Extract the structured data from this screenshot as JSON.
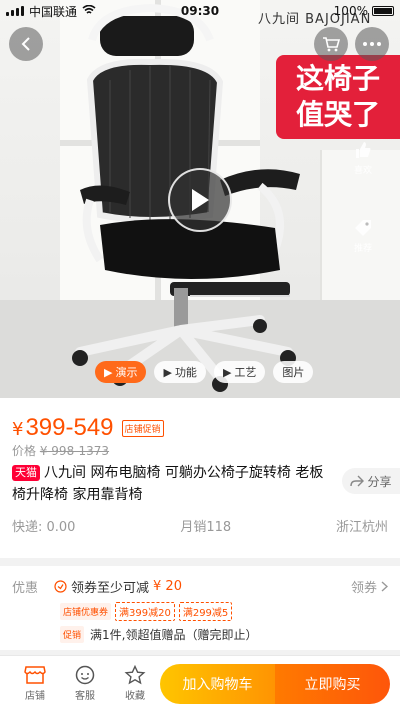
{
  "status_bar": {
    "carrier": "中国联通",
    "time": "09:30",
    "battery": "100%"
  },
  "hero": {
    "brand_mark": "八九间 BAJOJIAN",
    "banner_line1": "这椅子",
    "banner_line2": "值哭了",
    "like_label": "喜欢",
    "share_label": "推荐",
    "media_tabs": [
      {
        "label": "演示",
        "icon": "play-icon"
      },
      {
        "label": "功能",
        "icon": "play-icon"
      },
      {
        "label": "工艺",
        "icon": "play-icon"
      },
      {
        "label": "图片",
        "icon": ""
      }
    ]
  },
  "product": {
    "currency": "¥",
    "price": "399-549",
    "price_badge": "店铺促销",
    "original_label": "价格",
    "original_price": "¥ 998-1373",
    "mall_tag": "天猫",
    "title": "八九间 网布电脑椅 可躺办公椅子旋转椅 老板椅升降椅 家用靠背椅",
    "share": "分享",
    "shipping": "快递: 0.00",
    "monthly_sales": "月销118",
    "location": "浙江杭州"
  },
  "promotion": {
    "label": "优惠",
    "coupon_title": "领券至少可减",
    "coupon_amount": "¥ 20",
    "more": "领券",
    "store_tag": "店铺优惠券",
    "coupons": [
      "满399减20",
      "满299减5"
    ],
    "promo_tag": "促销",
    "promo_text": "满1件,领超值赠品（赠完即止）"
  },
  "bottom_bar": {
    "shop": "店铺",
    "service": "客服",
    "favorite": "收藏",
    "add_to_cart": "加入购物车",
    "buy_now": "立即购买"
  }
}
